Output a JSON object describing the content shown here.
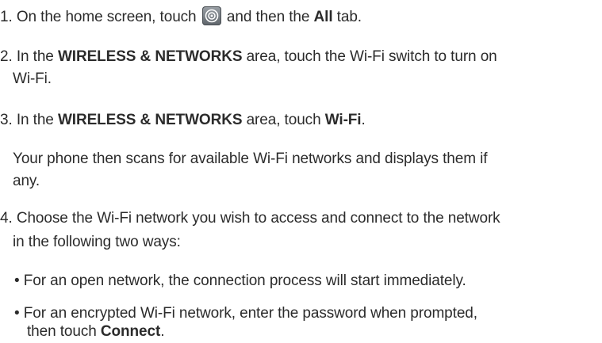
{
  "steps": {
    "s1": {
      "num": "1.",
      "pre": " On the home screen, touch ",
      "icon": "settings-icon",
      "mid": " and then the ",
      "bold": "All",
      "post": " tab."
    },
    "s2": {
      "num": "2.",
      "pre": " In the ",
      "bold": "WIRELESS & NETWORKS",
      "post": " area, touch the Wi-Fi switch to turn on",
      "cont": "Wi-Fi."
    },
    "s3": {
      "num": "3.",
      "pre": " In the ",
      "bold": "WIRELESS & NETWORKS",
      "mid": " area, touch ",
      "bold2": "Wi-Fi",
      "post": ".",
      "note_line1": "Your phone then scans for available Wi-Fi networks and displays them if",
      "note_line2": "any."
    },
    "s4": {
      "num": "4.",
      "line1": " Choose the Wi-Fi network you wish to access and connect to the network",
      "line2": "in the following two ways:",
      "bullet1": "• For an open network, the connection process will start immediately.",
      "bullet2_line1": "• For an encrypted Wi-Fi network, enter the password when prompted,",
      "bullet2_line2_pre": "then touch ",
      "bullet2_line2_bold": "Connect",
      "bullet2_line2_post": "."
    }
  }
}
